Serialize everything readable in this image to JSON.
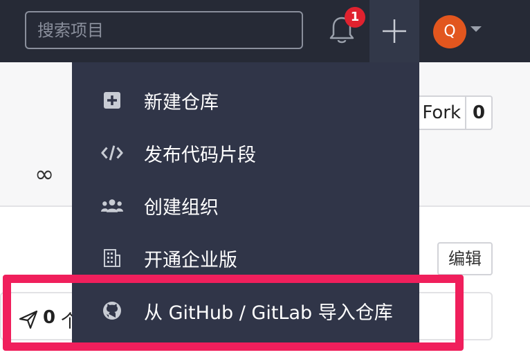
{
  "search": {
    "placeholder": "搜索项目"
  },
  "notifications": {
    "badge_count": "1"
  },
  "user": {
    "avatar_initial": "Q"
  },
  "repo": {
    "fork_label": "Fork",
    "fork_count": "0",
    "edit_label": "编辑",
    "panel_count": "0",
    "panel_unit": "个"
  },
  "dropdown": {
    "items": [
      {
        "label": "新建仓库",
        "icon": "plus-square-icon"
      },
      {
        "label": "发布代码片段",
        "icon": "code-icon"
      },
      {
        "label": "创建组织",
        "icon": "users-icon"
      },
      {
        "label": "开通企业版",
        "icon": "building-icon"
      },
      {
        "label": "从 GitHub / GitLab 导入仓库",
        "icon": "github-icon"
      }
    ]
  },
  "colors": {
    "topbar": "#262a36",
    "dropdown": "#303548",
    "badge": "#e0222f",
    "avatar": "#e2561e",
    "highlight": "#f01f5c"
  }
}
